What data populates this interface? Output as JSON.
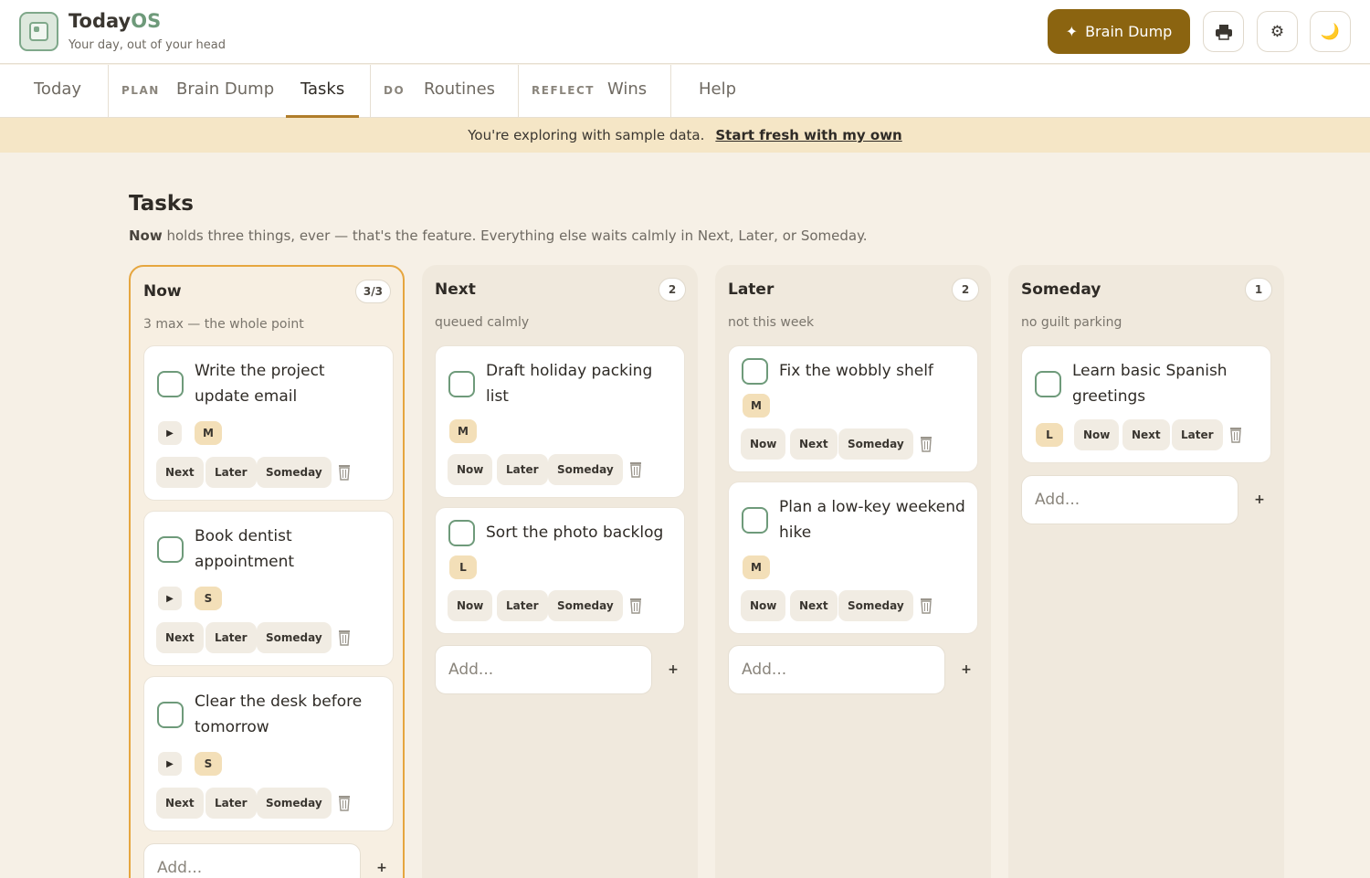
{
  "header": {
    "brand_main": "Today",
    "brand_accent": "OS",
    "subtitle": "Your day, out of your head",
    "brain_dump_button": "Brain Dump",
    "brain_dump_icon": "✦",
    "print_icon": "🖶",
    "settings_icon": "⚙",
    "theme_icon": "🌙"
  },
  "nav": {
    "today": "Today",
    "plan_label": "PLAN",
    "brain_dump": "Brain Dump",
    "tasks": "Tasks",
    "do_label": "DO",
    "routines": "Routines",
    "reflect_label": "REFLECT",
    "wins": "Wins",
    "help": "Help"
  },
  "banner": {
    "text": "You're exploring with sample data.",
    "link": "Start fresh with my own"
  },
  "page": {
    "title": "Tasks",
    "desc_bold": "Now",
    "desc_rest": " holds three things, ever — that's the feature. Everything else waits calmly in Next, Later, or Someday."
  },
  "columns": {
    "now": {
      "title": "Now",
      "count": "3/3",
      "subtitle": "3 max — the whole point",
      "add_placeholder": "Add...",
      "add_icon": "+",
      "tasks": [
        {
          "title": "Write the project update email",
          "play": "▶",
          "size": "M",
          "moves": [
            "Next",
            "Later",
            "Someday"
          ]
        },
        {
          "title": "Book dentist appointment",
          "play": "▶",
          "size": "S",
          "moves": [
            "Next",
            "Later",
            "Someday"
          ]
        },
        {
          "title": "Clear the desk before tomorrow",
          "play": "▶",
          "size": "S",
          "moves": [
            "Next",
            "Later",
            "Someday"
          ]
        }
      ]
    },
    "next": {
      "title": "Next",
      "count": "2",
      "subtitle": "queued calmly",
      "add_placeholder": "Add...",
      "add_icon": "+",
      "tasks": [
        {
          "title": "Draft holiday packing list",
          "size": "M",
          "moves": [
            "Now",
            "Later",
            "Someday"
          ]
        },
        {
          "title": "Sort the photo backlog",
          "size": "L",
          "moves": [
            "Now",
            "Later",
            "Someday"
          ]
        }
      ]
    },
    "later": {
      "title": "Later",
      "count": "2",
      "subtitle": "not this week",
      "add_placeholder": "Add...",
      "add_icon": "+",
      "tasks": [
        {
          "title": "Fix the wobbly shelf",
          "size": "M",
          "moves": [
            "Now",
            "Next",
            "Someday"
          ]
        },
        {
          "title": "Plan a low-key weekend hike",
          "size": "M",
          "moves": [
            "Now",
            "Next",
            "Someday"
          ]
        }
      ]
    },
    "someday": {
      "title": "Someday",
      "count": "1",
      "subtitle": "no guilt parking",
      "add_placeholder": "Add...",
      "add_icon": "+",
      "tasks": [
        {
          "title": "Learn basic Spanish greetings",
          "size": "L",
          "moves": [
            "Now",
            "Next",
            "Later"
          ]
        }
      ]
    }
  },
  "colors": {
    "accent": "#8b6410",
    "now_border": "#e6a63f",
    "check_green": "#6e9a7a",
    "banner_bg": "#f5e6c6"
  }
}
